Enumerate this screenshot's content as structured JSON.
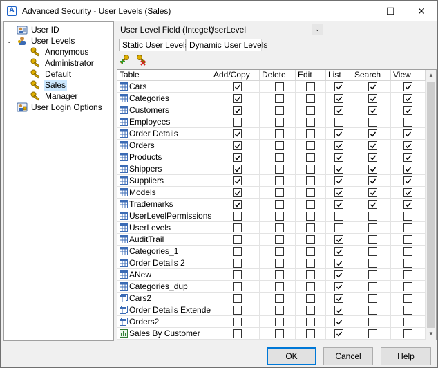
{
  "window": {
    "title": "Advanced Security - User Levels (Sales)",
    "minimize_glyph": "—",
    "maximize_glyph": "☐",
    "close_glyph": "✕"
  },
  "tree": {
    "root_items": [
      {
        "label": "User ID",
        "icon": "user-id-icon"
      },
      {
        "label": "User Levels",
        "icon": "user-levels-icon",
        "expanded": true
      },
      {
        "label": "User Login Options",
        "icon": "login-options-icon"
      }
    ],
    "levels": [
      {
        "label": "Anonymous",
        "selected": false
      },
      {
        "label": "Administrator",
        "selected": false
      },
      {
        "label": "Default",
        "selected": false
      },
      {
        "label": "Sales",
        "selected": true
      },
      {
        "label": "Manager",
        "selected": false
      }
    ],
    "toggle_glyph": "⌄"
  },
  "field": {
    "label": "User Level Field (Integer)",
    "value": "UserLevel",
    "dropdown_glyph": "⌄"
  },
  "tabs": [
    {
      "label": "Static User Levels",
      "active": true
    },
    {
      "label": "Dynamic User Levels",
      "active": false
    }
  ],
  "toolbar": {
    "add_icon": "key-add-icon",
    "remove_icon": "key-remove-icon"
  },
  "grid": {
    "columns": [
      "Table",
      "Add/Copy",
      "Delete",
      "Edit",
      "List",
      "Search",
      "View"
    ],
    "rows": [
      {
        "name": "Cars",
        "icon": "table",
        "perms": [
          1,
          0,
          0,
          1,
          1,
          1
        ]
      },
      {
        "name": "Categories",
        "icon": "table",
        "perms": [
          1,
          0,
          0,
          1,
          1,
          1
        ]
      },
      {
        "name": "Customers",
        "icon": "table",
        "perms": [
          1,
          0,
          0,
          1,
          1,
          1
        ]
      },
      {
        "name": "Employees",
        "icon": "table",
        "perms": [
          0,
          0,
          0,
          0,
          0,
          0
        ]
      },
      {
        "name": "Order Details",
        "icon": "table",
        "perms": [
          1,
          0,
          0,
          1,
          1,
          1
        ]
      },
      {
        "name": "Orders",
        "icon": "table",
        "perms": [
          1,
          0,
          0,
          1,
          1,
          1
        ]
      },
      {
        "name": "Products",
        "icon": "table",
        "perms": [
          1,
          0,
          0,
          1,
          1,
          1
        ]
      },
      {
        "name": "Shippers",
        "icon": "table",
        "perms": [
          1,
          0,
          0,
          1,
          1,
          1
        ]
      },
      {
        "name": "Suppliers",
        "icon": "table",
        "perms": [
          1,
          0,
          0,
          1,
          1,
          1
        ]
      },
      {
        "name": "Models",
        "icon": "table",
        "perms": [
          1,
          0,
          0,
          1,
          1,
          1
        ]
      },
      {
        "name": "Trademarks",
        "icon": "table",
        "perms": [
          1,
          0,
          0,
          1,
          1,
          1
        ]
      },
      {
        "name": "UserLevelPermissions",
        "icon": "table",
        "perms": [
          0,
          0,
          0,
          0,
          0,
          0
        ]
      },
      {
        "name": "UserLevels",
        "icon": "table",
        "perms": [
          0,
          0,
          0,
          0,
          0,
          0
        ]
      },
      {
        "name": "AuditTrail",
        "icon": "table",
        "perms": [
          0,
          0,
          0,
          1,
          0,
          0
        ]
      },
      {
        "name": "Categories_1",
        "icon": "table",
        "perms": [
          0,
          0,
          0,
          1,
          0,
          0
        ]
      },
      {
        "name": "Order Details 2",
        "icon": "table",
        "perms": [
          0,
          0,
          0,
          1,
          0,
          0
        ]
      },
      {
        "name": "ANew",
        "icon": "table",
        "perms": [
          0,
          0,
          0,
          1,
          0,
          0
        ]
      },
      {
        "name": "Categories_dup",
        "icon": "table",
        "perms": [
          0,
          0,
          0,
          1,
          0,
          0
        ]
      },
      {
        "name": "Cars2",
        "icon": "view",
        "perms": [
          0,
          0,
          0,
          1,
          0,
          0
        ]
      },
      {
        "name": "Order Details Extended",
        "icon": "view",
        "perms": [
          0,
          0,
          0,
          1,
          0,
          0
        ]
      },
      {
        "name": "Orders2",
        "icon": "view",
        "perms": [
          0,
          0,
          0,
          1,
          0,
          0
        ]
      },
      {
        "name": "Sales By Customer",
        "icon": "report",
        "perms": [
          0,
          0,
          0,
          1,
          0,
          0
        ]
      }
    ]
  },
  "buttons": {
    "ok": "OK",
    "cancel": "Cancel",
    "help": "Help"
  },
  "colors": {
    "selection": "#cce8ff",
    "default_button_border": "#0078d7"
  }
}
